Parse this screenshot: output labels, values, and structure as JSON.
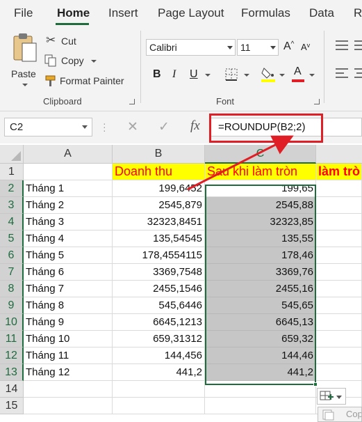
{
  "menu": {
    "tabs": [
      "File",
      "Home",
      "Insert",
      "Page Layout",
      "Formulas",
      "Data",
      "Re"
    ],
    "active": "Home"
  },
  "ribbon": {
    "clipboard": {
      "paste_label": "Paste",
      "cut_label": "Cut",
      "copy_label": "Copy",
      "format_painter_label": "Format Painter",
      "group_label": "Clipboard"
    },
    "font": {
      "font_name": "Calibri",
      "font_size": "11",
      "bold": "B",
      "italic": "I",
      "underline": "U",
      "font_color_glyph": "A",
      "grow_glyph": "A",
      "shrink_glyph": "A",
      "group_label": "Font"
    }
  },
  "formula_bar": {
    "name_box": "C2",
    "cancel_glyph": "✕",
    "enter_glyph": "✓",
    "fx_glyph": "fx",
    "formula": "=ROUNDUP(B2;2)"
  },
  "grid": {
    "columns": [
      "A",
      "B",
      "C"
    ],
    "header_row": {
      "B": "Doanh thu",
      "C": "Sau khi làm tròn",
      "D": "làm trò"
    },
    "rows": [
      {
        "num": "1",
        "A": "",
        "B": "",
        "C": ""
      },
      {
        "num": "2",
        "A": "Tháng 1",
        "B": "199,6452",
        "C": "199,65"
      },
      {
        "num": "3",
        "A": "Tháng 2",
        "B": "2545,879",
        "C": "2545,88"
      },
      {
        "num": "4",
        "A": "Tháng 3",
        "B": "32323,8451",
        "C": "32323,85"
      },
      {
        "num": "5",
        "A": "Tháng 4",
        "B": "135,54545",
        "C": "135,55"
      },
      {
        "num": "6",
        "A": "Tháng 5",
        "B": "178,4554115",
        "C": "178,46"
      },
      {
        "num": "7",
        "A": "Tháng 6",
        "B": "3369,7548",
        "C": "3369,76"
      },
      {
        "num": "8",
        "A": "Tháng 7",
        "B": "2455,1546",
        "C": "2455,16"
      },
      {
        "num": "9",
        "A": "Tháng 8",
        "B": "545,6446",
        "C": "545,65"
      },
      {
        "num": "10",
        "A": "Tháng 9",
        "B": "6645,1213",
        "C": "6645,13"
      },
      {
        "num": "11",
        "A": "Tháng 10",
        "B": "659,31312",
        "C": "659,32"
      },
      {
        "num": "12",
        "A": "Tháng 11",
        "B": "144,456",
        "C": "144,46"
      },
      {
        "num": "13",
        "A": "Tháng 12",
        "B": "441,2",
        "C": "441,2"
      },
      {
        "num": "14",
        "A": "",
        "B": "",
        "C": ""
      },
      {
        "num": "15",
        "A": "",
        "B": "",
        "C": ""
      }
    ]
  },
  "popup_text": "Cop",
  "colors": {
    "accent": "#1e6b3e",
    "header_fill": "#ffff00",
    "header_text": "#ff0000",
    "annotation": "#e01e26"
  }
}
